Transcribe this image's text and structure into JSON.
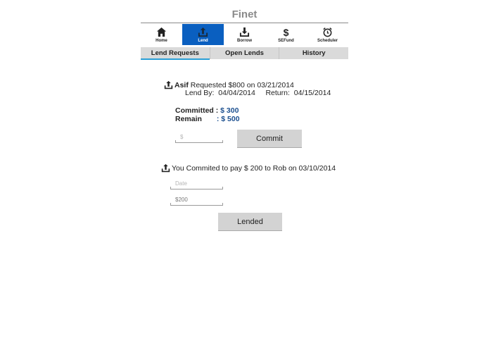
{
  "app": {
    "title": "Finet"
  },
  "nav": [
    {
      "label": "Home",
      "icon": "home-icon"
    },
    {
      "label": "Lend",
      "icon": "lend-icon",
      "active": true
    },
    {
      "label": "Borrow",
      "icon": "borrow-icon"
    },
    {
      "label": "SEFund",
      "icon": "dollar-icon"
    },
    {
      "label": "Scheduler",
      "icon": "clock-icon"
    }
  ],
  "colors": {
    "active_nav": "#0a5fc0",
    "tab_underline": "#2a9fd6",
    "value_blue": "#1b4f8f",
    "title_gray": "#8a8a8a"
  },
  "tabs": [
    {
      "label": "Lend Requests",
      "active": true
    },
    {
      "label": "Open Lends"
    },
    {
      "label": "History"
    }
  ],
  "request": {
    "name": "Asif",
    "text": "Requested $800 on 03/21/2014",
    "lend_by_label": "Lend By:",
    "lend_by_date": "04/04/2014",
    "return_label": "Return:",
    "return_date": "04/15/2014",
    "committed_label": "Committed :",
    "committed_value": "$ 300",
    "remain_label": "Remain",
    "remain_value": ": $ 500",
    "amount_placeholder": "$",
    "commit_button": "Commit"
  },
  "payment": {
    "text": "You Commited to pay $ 200 to Rob on 03/10/2014",
    "date_placeholder": "Date",
    "amount_value": "$200",
    "lended_button": "Lended"
  }
}
